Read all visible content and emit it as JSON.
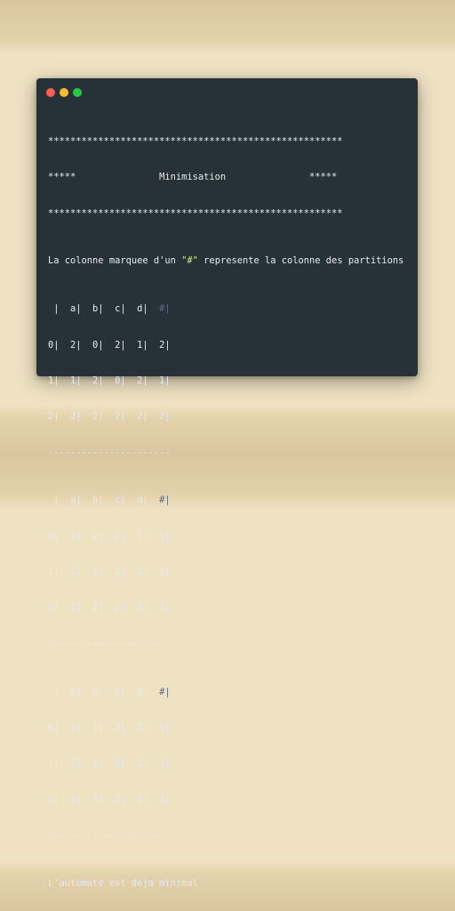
{
  "window_controls": [
    "close",
    "minimize",
    "maximize"
  ],
  "terminal": {
    "header": [
      "*****************************************************",
      "*****               Minimisation               *****",
      "*****************************************************"
    ],
    "legend": {
      "before": "La colonne marquee d'un ",
      "marker": "\"#\"",
      "after": " represente la colonne des partitions"
    },
    "tables": [
      {
        "header_main": " |  a|  b|  c|  d|",
        "header_marker": "  #|",
        "rows": [
          "0|  2|  0|  2|  1|  2|",
          "1|  1|  2|  0|  2|  1|",
          "2|  2|  2|  2|  2|  2|"
        ],
        "separator": "----------------------"
      },
      {
        "header_main": " |  a|  b|  c|  d|",
        "header_marker": "  #|",
        "rows": [
          "0|  2|  2|  2|  1|  1|",
          "1|  1|  2|  2|  2|  2|",
          "2|  2|  2|  2|  2|  3|"
        ],
        "separator": "----------------------"
      },
      {
        "header_main": " |  a|  b|  c|  d|",
        "header_marker": "  #|",
        "rows": [
          "0|  3|  1|  3|  2|  1|",
          "1|  2|  3|  1|  3|  2|",
          "2|  3|  3|  3|  3|  3|"
        ],
        "separator": "----------------------"
      }
    ],
    "result": "L'automate est deja minimal"
  },
  "colors": {
    "background": "#263238",
    "text": "#e8eaed",
    "highlight": "#c3e88d",
    "dim": "#5c6b89"
  }
}
